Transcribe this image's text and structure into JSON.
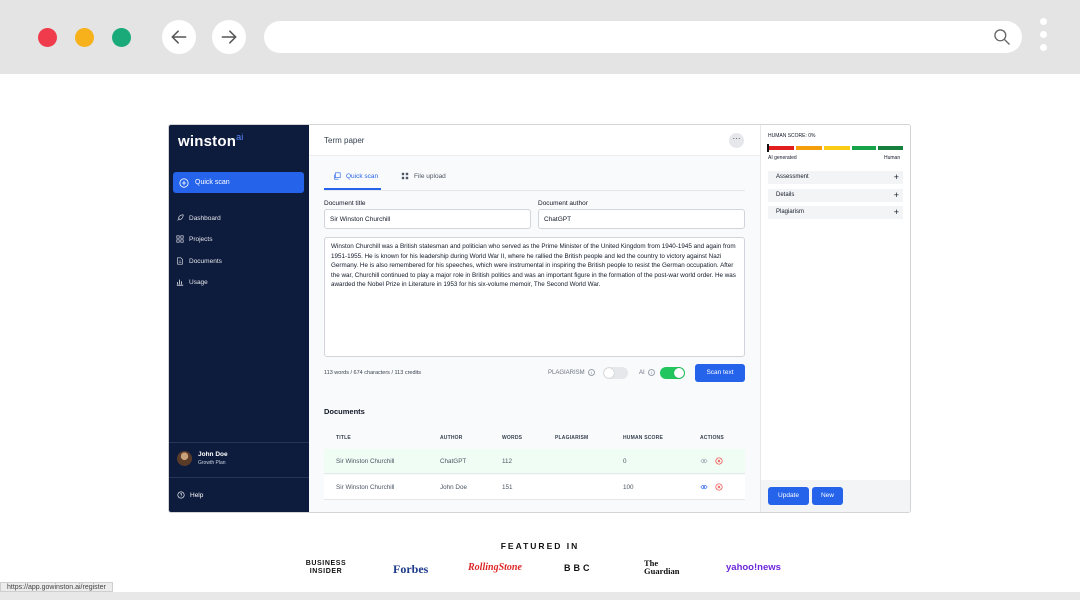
{
  "colors": {
    "close": "#ef3b4c",
    "minimize": "#f7b11b",
    "maximize": "#1aaa7a",
    "sidebar": "#0d1b3d",
    "accent": "#2563eb",
    "toggle_on": "#22c55e",
    "toggle_off": "#e5e7eb"
  },
  "browser": {
    "close_icon": "circle",
    "back_icon": "arrow-left",
    "forward_icon": "arrow-right",
    "search_icon": "magnifier",
    "menu_icon": "three-dots",
    "status_url": "https://app.gowinston.ai/register"
  },
  "sidebar": {
    "logo": "winston",
    "logo_sup": "ai",
    "quick_scan": "Quick scan",
    "items": [
      {
        "label": "Dashboard",
        "icon": "rocket-icon"
      },
      {
        "label": "Projects",
        "icon": "grid-icon"
      },
      {
        "label": "Documents",
        "icon": "document-icon"
      },
      {
        "label": "Usage",
        "icon": "bar-chart-icon"
      }
    ],
    "user": {
      "name": "John Doe",
      "plan": "Growth Plan"
    },
    "help": "Help"
  },
  "main": {
    "title": "Term paper",
    "more": "···",
    "tabs": [
      {
        "label": "Quick scan",
        "icon": "copy-icon",
        "active": true
      },
      {
        "label": "File upload",
        "icon": "grid-icon",
        "active": false
      }
    ],
    "title_label": "Document title",
    "title_value": "Sir Winston Churchill",
    "author_label": "Document author",
    "author_value": "ChatGPT",
    "body": "Winston Churchill was a British statesman and politician who served as the Prime Minister of the United Kingdom from 1940-1945 and again from 1951-1955. He is known for his leadership during World War II, where he rallied the British people and led the country to victory against Nazi Germany. He is also remembered for his speeches, which were instrumental in inspiring the British people to resist the German occupation. After the war, Churchill continued to play a major role in British politics and was an important figure in the formation of the post-war world order. He was awarded the Nobel Prize in Literature in 1953 for his six-volume memoir, The Second World War.",
    "counts": "113 words / 674 characters / 113 credits",
    "plagiarism_label": "PLAGIARISM",
    "plagiarism_on": false,
    "ai_label": "AI",
    "ai_on": true,
    "scan_button": "Scan text",
    "documents_title": "Documents",
    "table": {
      "headers": [
        "TITLE",
        "AUTHOR",
        "WORDS",
        "PLAGIARISM",
        "HUMAN SCORE",
        "ACTIONS"
      ],
      "rows": [
        {
          "title": "Sir Winston Churchill",
          "author": "ChatGPT",
          "words": "112",
          "plagiarism": "",
          "human_score": "0"
        },
        {
          "title": "Sir Winston Churchill",
          "author": "John Doe",
          "words": "151",
          "plagiarism": "",
          "human_score": "100"
        }
      ]
    }
  },
  "right": {
    "human_score": "HUMAN SCORE: 0%",
    "scale_colors": [
      "#e11d1d",
      "#f59e0b",
      "#facc15",
      "#16a34a",
      "#15803d"
    ],
    "left_end": "AI generated",
    "right_end": "Human",
    "accordions": [
      "Assessment",
      "Details",
      "Plagiarism"
    ],
    "plus": "+",
    "update": "Update",
    "new": "New"
  },
  "featured": {
    "title": "FEATURED IN",
    "logos": [
      "BUSINESS INSIDER",
      "Forbes",
      "RollingStone",
      "BBC",
      "The Guardian",
      "yahoo!news"
    ]
  }
}
